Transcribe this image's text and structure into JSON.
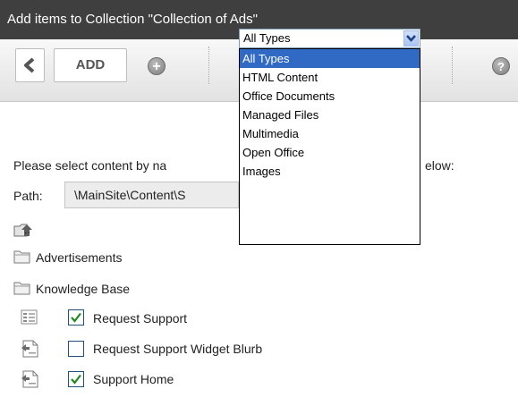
{
  "window": {
    "title": "Add items to Collection \"Collection of Ads\""
  },
  "toolbar": {
    "back_icon": "chevron-left-icon",
    "add_label": "ADD",
    "plus_icon": "plus-circle-icon",
    "help_icon": "help-circle-icon",
    "type_select": {
      "value": "All Types",
      "options": [
        "All Types",
        "HTML Content",
        "Office Documents",
        "Managed Files",
        "Multimedia",
        "Open Office",
        "Images"
      ]
    }
  },
  "content": {
    "instruction_visible": "Please select content by na",
    "instruction_tail": "elow:",
    "path_label": "Path:",
    "path_value": "\\MainSite\\Content\\S"
  },
  "tree": {
    "up_label": "..",
    "folders": [
      "Advertisements",
      "Knowledge Base"
    ],
    "items": [
      {
        "label": "Request Support",
        "checked": true,
        "icon": "form-icon"
      },
      {
        "label": "Request Support Widget Blurb",
        "checked": false,
        "icon": "document-icon"
      },
      {
        "label": "Support Home",
        "checked": true,
        "icon": "document-icon"
      }
    ]
  },
  "colors": {
    "titlebar": "#3f3f3f",
    "selection": "#316ac5",
    "checkmark": "#1e8a1e"
  }
}
